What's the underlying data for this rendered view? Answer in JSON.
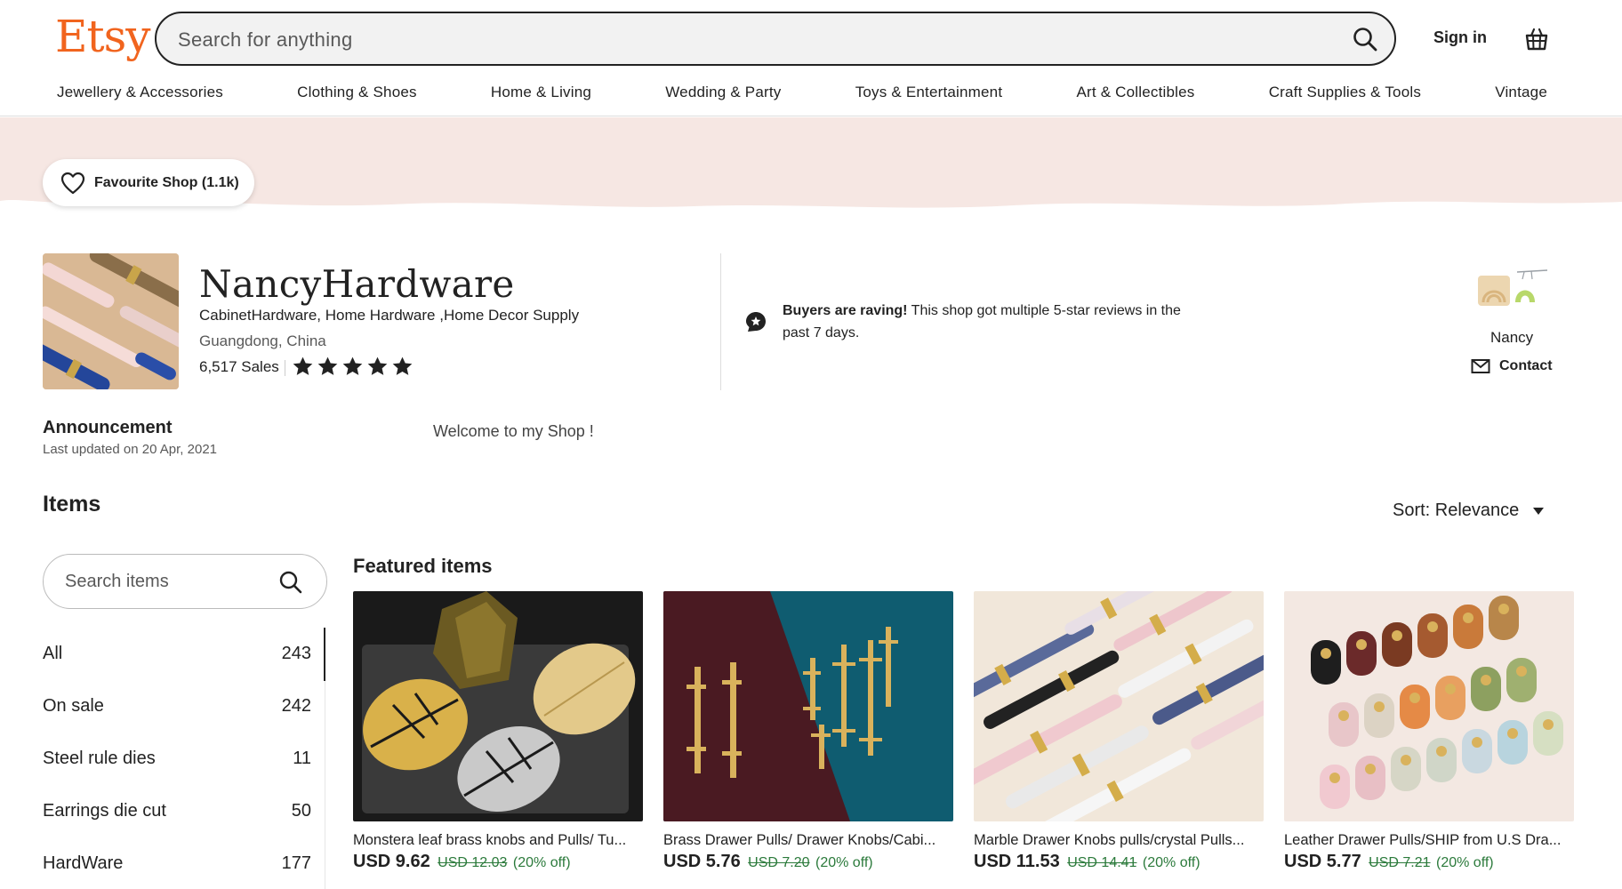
{
  "header": {
    "logo": "Etsy",
    "search_placeholder": "Search for anything",
    "sign_in": "Sign in"
  },
  "categories": [
    "Jewellery & Accessories",
    "Clothing & Shoes",
    "Home & Living",
    "Wedding & Party",
    "Toys & Entertainment",
    "Art & Collectibles",
    "Craft Supplies & Tools",
    "Vintage"
  ],
  "colors": {
    "brand": "#F1641E",
    "banner": "#F6E7E3",
    "sale": "#2b7a3b"
  },
  "favourite_label": "Favourite Shop (1.1k)",
  "shop": {
    "name": "NancyHardware",
    "tagline": "CabinetHardware, Home Hardware ,Home Decor Supply",
    "location": "Guangdong, China",
    "sales": "6,517 Sales",
    "rating": 5
  },
  "raving": {
    "bold": "Buyers are raving!",
    "text": " This shop got multiple 5-star reviews in the past 7 days."
  },
  "owner": {
    "name": "Nancy",
    "contact": "Contact"
  },
  "announcement": {
    "title": "Announcement",
    "updated": "Last updated on 20 Apr, 2021",
    "message": "Welcome to my Shop !"
  },
  "items": {
    "title": "Items",
    "sort": "Sort: Relevance",
    "search_placeholder": "Search items",
    "sections": [
      {
        "label": "All",
        "count": "243"
      },
      {
        "label": "On sale",
        "count": "242"
      },
      {
        "label": "Steel rule dies",
        "count": "11"
      },
      {
        "label": "Earrings die cut",
        "count": "50"
      },
      {
        "label": "HardWare",
        "count": "177"
      }
    ]
  },
  "featured": {
    "title": "Featured items",
    "cards": [
      {
        "title": "Monstera leaf brass knobs and Pulls/ Tu...",
        "price": "USD 9.62",
        "old_price": "USD 12.03",
        "discount": "(20% off)"
      },
      {
        "title": "Brass Drawer Pulls/ Drawer Knobs/Cabi...",
        "price": "USD 5.76",
        "old_price": "USD 7.20",
        "discount": "(20% off)"
      },
      {
        "title": "Marble Drawer Knobs pulls/crystal Pulls...",
        "price": "USD 11.53",
        "old_price": "USD 14.41",
        "discount": "(20% off)"
      },
      {
        "title": "Leather Drawer Pulls/SHIP from U.S Dra...",
        "price": "USD 5.77",
        "old_price": "USD 7.21",
        "discount": "(20% off)"
      }
    ]
  }
}
